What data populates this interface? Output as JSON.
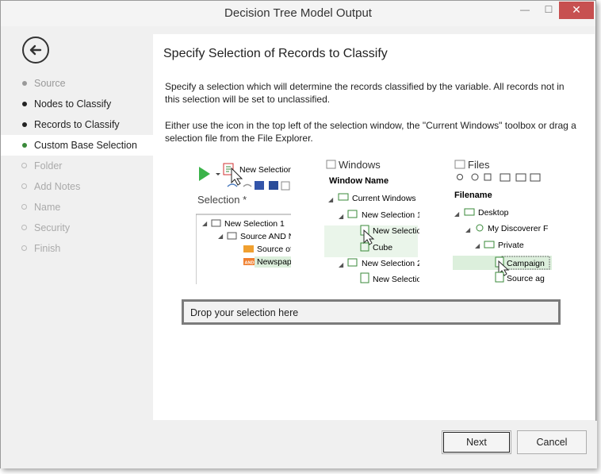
{
  "window": {
    "title": "Decision Tree Model Output"
  },
  "titlebar_buttons": {
    "minimize": "—",
    "maximize": "☐",
    "close": "✕"
  },
  "sidebar": {
    "steps": [
      {
        "label": "Source",
        "state": "done"
      },
      {
        "label": "Nodes to Classify",
        "state": "visited"
      },
      {
        "label": "Records to Classify",
        "state": "visited"
      },
      {
        "label": "Custom Base Selection",
        "state": "current"
      },
      {
        "label": "Folder",
        "state": "todo"
      },
      {
        "label": "Add Notes",
        "state": "todo"
      },
      {
        "label": "Name",
        "state": "todo"
      },
      {
        "label": "Security",
        "state": "todo"
      },
      {
        "label": "Finish",
        "state": "todo"
      }
    ]
  },
  "main": {
    "heading": "Specify Selection of Records to Classify",
    "para1": "Specify a selection which will determine the records classified by the variable.  All records not in this selection will be set to unclassified.",
    "para2": "Either use the icon in the top left of the selection window, the \"Current Windows\" toolbox or drag a selection file from the File Explorer."
  },
  "illustration1": {
    "toolbar_item": "New Selection",
    "panel_title": "Selection *",
    "tree": [
      "New Selection 1",
      "Source AND N",
      "Source of",
      "Newspap"
    ],
    "badge": "AND"
  },
  "illustration2": {
    "title": "Windows",
    "header": "Window Name",
    "tree": [
      "Current Windows",
      "New Selection 1",
      "New Selectio",
      "Cube",
      "New Selection 2",
      "New Selectio"
    ]
  },
  "illustration3": {
    "title": "Files",
    "header": "Filename",
    "tree": [
      "Desktop",
      "My Discoverer F",
      "Private",
      "Campaign",
      "Source ag"
    ]
  },
  "dropzone": {
    "label": "Drop your selection here"
  },
  "footer": {
    "next_label": "Next",
    "cancel_label": "Cancel"
  },
  "colors": {
    "accent_green": "#3a8a3a",
    "close_red": "#c75050",
    "highlight_green": "#dcefdc"
  }
}
